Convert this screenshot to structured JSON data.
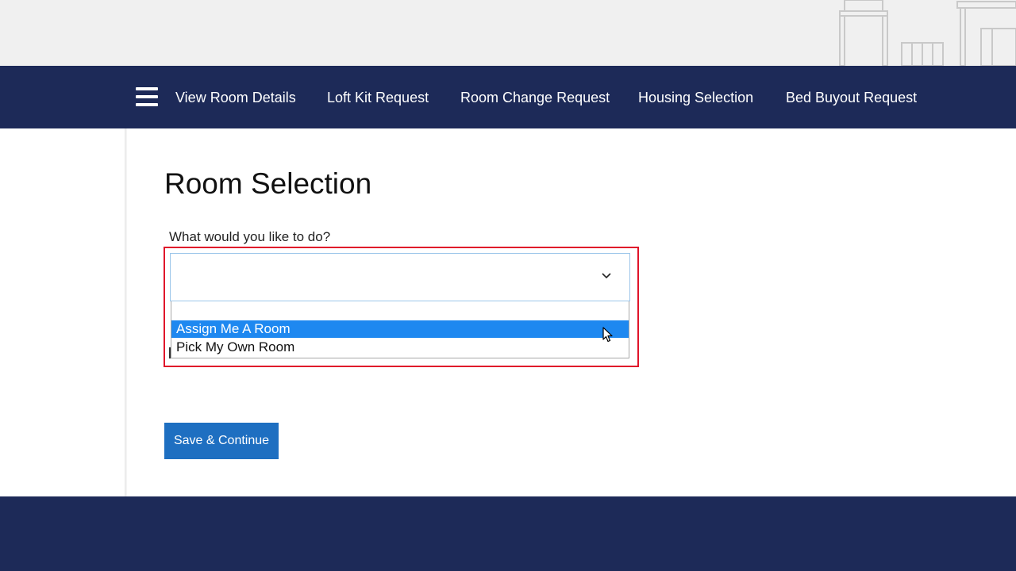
{
  "nav": {
    "menu_icon": "hamburger-menu-icon",
    "links": [
      "View Room Details",
      "Loft Kit Request",
      "Room Change Request",
      "Housing Selection",
      "Bed Buyout Request"
    ]
  },
  "page": {
    "title": "Room Selection",
    "question_label": "What would you like to do?"
  },
  "select": {
    "value": "",
    "chevron_icon": "chevron-down-icon",
    "options": [
      "",
      "Assign Me A Room",
      "Pick My Own Room"
    ],
    "highlighted_option": "Assign Me A Room"
  },
  "actions": {
    "save_label": "Save & Continue"
  },
  "colors": {
    "navbar": "#1d2a58",
    "highlight_border": "#e0142a",
    "option_selected": "#1e88f0",
    "button": "#1e6fc1"
  }
}
